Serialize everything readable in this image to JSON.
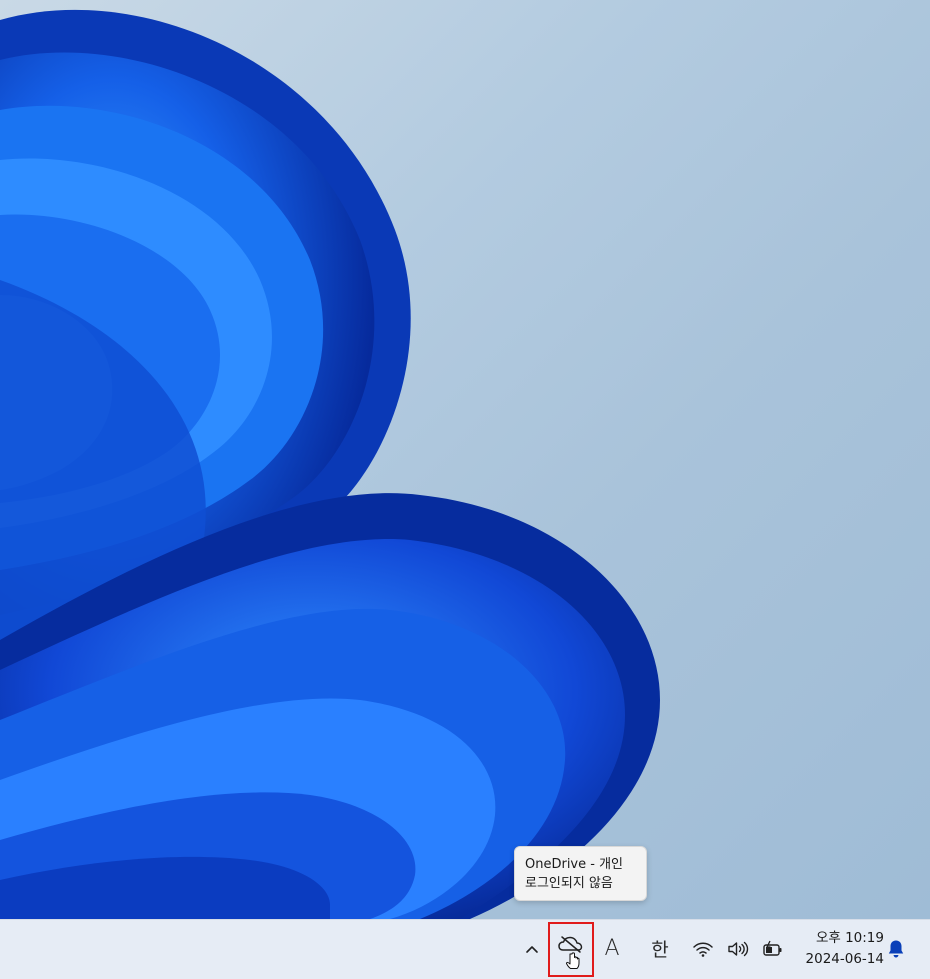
{
  "tooltip": {
    "line1": "OneDrive - 개인",
    "line2": "로그인되지 않음"
  },
  "taskbar": {
    "tray": {
      "chevron_icon": "chevron-up-icon",
      "onedrive_icon": "onedrive-cloud-offline-icon",
      "ime_mode_latin": "A",
      "ime_mode_hangul": "한",
      "wifi_icon": "wifi-icon",
      "volume_icon": "volume-icon",
      "battery_icon": "battery-charging-icon"
    },
    "clock": {
      "time": "오후 10:19",
      "date": "2024-06-14"
    },
    "notification_icon": "bell-icon"
  },
  "colors": {
    "highlight_border": "#e01b1b",
    "taskbar_bg": "#e6ecf5",
    "bell": "#0a3fb8"
  }
}
